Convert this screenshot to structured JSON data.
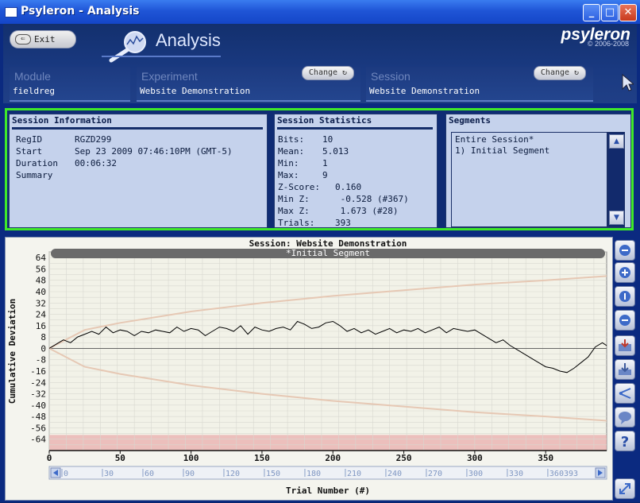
{
  "window": {
    "title": "Psyleron - Analysis",
    "buttons": {
      "minimize": "_",
      "maximize": "□",
      "close": "✕"
    }
  },
  "header": {
    "exit_label": "Exit",
    "app_title": "Analysis",
    "brand": "psyleron",
    "copyright": "© 2006-2008",
    "module": {
      "label": "Module",
      "value": "fieldreg"
    },
    "experiment": {
      "label": "Experiment",
      "value": "Website Demonstration",
      "change_label": "Change"
    },
    "session": {
      "label": "Session",
      "value": "Website Demonstration",
      "change_label": "Change"
    }
  },
  "session_info": {
    "title": "Session Information",
    "rows": [
      {
        "key": "RegID",
        "value": "RGZD299"
      },
      {
        "key": "Start",
        "value": "Sep 23 2009 07:46:10PM (GMT-5)"
      },
      {
        "key": "Duration",
        "value": "00:06:32"
      },
      {
        "key": "Summary",
        "value": ""
      }
    ]
  },
  "session_stats": {
    "title": "Session Statistics",
    "rows": [
      {
        "key": "Bits:",
        "value": "10"
      },
      {
        "key": "Mean:",
        "value": "5.013"
      },
      {
        "key": "Min:",
        "value": "1"
      },
      {
        "key": "Max:",
        "value": "9"
      },
      {
        "key": "Z-Score:",
        "value": "0.160"
      },
      {
        "key": "Min Z:",
        "value": " -0.528 (#367)"
      },
      {
        "key": "Max Z:",
        "value": " 1.673 (#28)"
      },
      {
        "key": "Trials:",
        "value": "393"
      }
    ]
  },
  "segments": {
    "title": "Segments",
    "items": [
      "Entire Session*",
      "1) Initial Segment"
    ]
  },
  "chart_data": {
    "type": "line",
    "title": "Session: Website Demonstration",
    "segment_label": "*Initial Segment",
    "xlabel": "Trial Number (#)",
    "ylabel": "Cumulative Deviation",
    "xlim": [
      0,
      393
    ],
    "ylim": [
      -72,
      68
    ],
    "xticks": [
      0,
      50,
      100,
      150,
      200,
      250,
      300,
      350
    ],
    "yticks": [
      64,
      56,
      48,
      40,
      32,
      24,
      16,
      8,
      0,
      -8,
      -16,
      -24,
      -32,
      -40,
      -48,
      -56,
      -64
    ],
    "grid": true,
    "colors": {
      "series": "#000000",
      "envelope": "#e6c8b4",
      "bottom_band": "#e9a9a9",
      "segment_bar": "#6a6a6a"
    },
    "series": [
      {
        "x": [
          0,
          5,
          10,
          15,
          20,
          25,
          30,
          35,
          40,
          45,
          50,
          55,
          60,
          65,
          70,
          75,
          80,
          85,
          90,
          95,
          100,
          105,
          110,
          115,
          120,
          125,
          130,
          135,
          140,
          145,
          150,
          155,
          160,
          165,
          170,
          175,
          180,
          185,
          190,
          195,
          200,
          205,
          210,
          215,
          220,
          225,
          230,
          235,
          240,
          245,
          250,
          255,
          260,
          265,
          270,
          275,
          280,
          285,
          290,
          295,
          300,
          305,
          310,
          315,
          320,
          325,
          330,
          335,
          340,
          345,
          350,
          355,
          360,
          365,
          370,
          375,
          380,
          385,
          390,
          393
        ],
        "y": [
          0,
          3,
          6,
          4,
          8,
          10,
          12,
          10,
          15,
          11,
          13,
          12,
          9,
          12,
          11,
          13,
          12,
          11,
          15,
          12,
          14,
          13,
          9,
          12,
          15,
          14,
          12,
          16,
          10,
          15,
          13,
          12,
          14,
          15,
          13,
          19,
          17,
          14,
          15,
          18,
          19,
          16,
          12,
          14,
          11,
          13,
          10,
          12,
          14,
          11,
          13,
          12,
          14,
          11,
          13,
          15,
          11,
          14,
          13,
          12,
          13,
          10,
          7,
          4,
          6,
          2,
          -1,
          -4,
          -7,
          -10,
          -13,
          -14,
          -16,
          -17,
          -14,
          -10,
          -6,
          1,
          4,
          2
        ]
      },
      {
        "name": "upper envelope",
        "x": [
          0,
          25,
          50,
          100,
          150,
          200,
          250,
          300,
          350,
          393
        ],
        "y": [
          0,
          13,
          18,
          26,
          32,
          37,
          41,
          45,
          48,
          51
        ]
      },
      {
        "name": "lower envelope",
        "x": [
          0,
          25,
          50,
          100,
          150,
          200,
          250,
          300,
          350,
          393
        ],
        "y": [
          0,
          -13,
          -18,
          -26,
          -32,
          -37,
          -41,
          -45,
          -48,
          -51
        ]
      }
    ],
    "scrollbar_ticks": [
      "0",
      "30",
      "60",
      "90",
      "120",
      "150",
      "180",
      "210",
      "240",
      "270",
      "300",
      "330",
      "360393"
    ]
  }
}
